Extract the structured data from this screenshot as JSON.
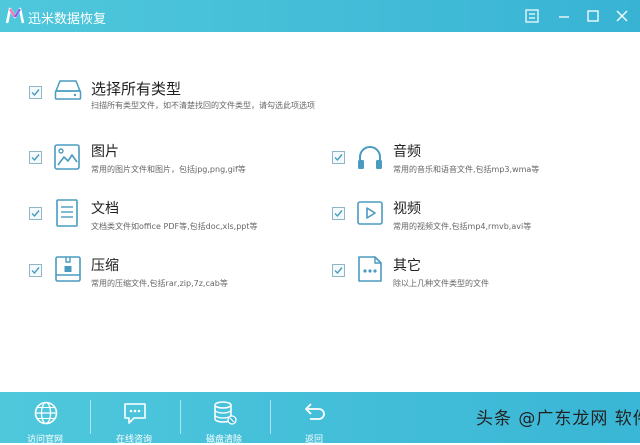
{
  "app": {
    "title": "迅米数据恢复"
  },
  "types": {
    "all": {
      "name": "选择所有类型",
      "desc": "扫描所有类型文件，如不清楚找回的文件类型，请勾选此项选项",
      "checked": true
    },
    "image": {
      "name": "图片",
      "desc": "常用的图片文件和图片，包括jpg,png,gif等",
      "checked": true
    },
    "audio": {
      "name": "音频",
      "desc": "常用的音乐和语音文件,包括mp3,wma等",
      "checked": true
    },
    "doc": {
      "name": "文档",
      "desc": "文档类文件如office PDF等,包括doc,xls,ppt等",
      "checked": true
    },
    "video": {
      "name": "视频",
      "desc": "常用的视频文件,包括mp4,rmvb,avi等",
      "checked": true
    },
    "zip": {
      "name": "压缩",
      "desc": "常用的压缩文件,包括rar,zip,7z,cab等",
      "checked": true
    },
    "other": {
      "name": "其它",
      "desc": "除以上几种文件类型的文件",
      "checked": true
    }
  },
  "bottom": {
    "website": "访问官网",
    "consult": "在线咨询",
    "wipe": "磁盘清除",
    "back": "返回"
  },
  "watermark": "头条 @广东龙网 软件",
  "colors": {
    "accent": "#3ab6d6",
    "icon": "#4a9bbf"
  }
}
